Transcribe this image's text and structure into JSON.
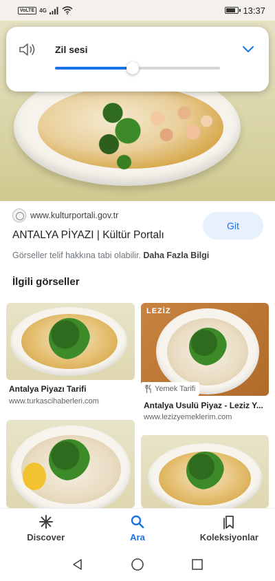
{
  "status_bar": {
    "network": "4G",
    "volte": "VoLTE",
    "time": "13:37"
  },
  "volume_panel": {
    "label": "Zil sesi",
    "level_fraction": 0.47
  },
  "result": {
    "site_url": "www.kulturportali.gov.tr",
    "title": "ANTALYA PİYAZI | Kültür Portalı",
    "copyright_text": "Görseller telif hakkına tabi olabilir.",
    "more_info": "Daha Fazla Bilgi",
    "visit_button": "Git"
  },
  "related": {
    "heading": "İlgili görseller",
    "items": [
      {
        "title": "Antalya Piyazı Tarifi",
        "url": "www.turkascihaberleri.com"
      },
      {
        "title": "Antalya Usulü Piyaz - Leziz Y...",
        "url": "www.lezizyemeklerim.com",
        "badge": "Yemek Tarifi",
        "logo": "LEZİZ"
      }
    ]
  },
  "bottom_nav": {
    "items": [
      {
        "label": "Discover",
        "icon": "asterisk-icon"
      },
      {
        "label": "Ara",
        "icon": "search-icon",
        "active": true
      },
      {
        "label": "Koleksiyonlar",
        "icon": "bookmarks-icon"
      }
    ]
  },
  "colors": {
    "accent": "#1a73e8",
    "button_bg": "#e7f0fd"
  }
}
